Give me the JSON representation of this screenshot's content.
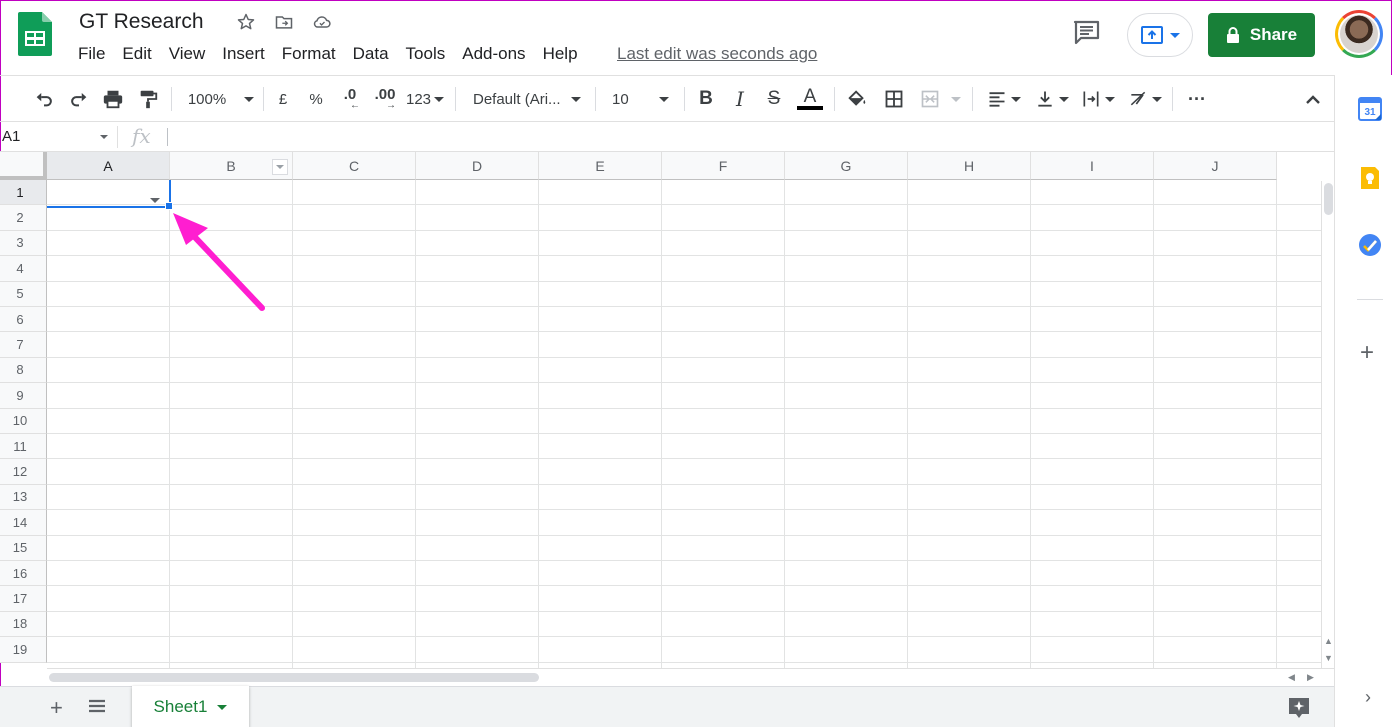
{
  "app": {
    "doc_title": "GT Research",
    "last_edit": "Last edit was seconds ago"
  },
  "menu": [
    "File",
    "Edit",
    "View",
    "Insert",
    "Format",
    "Data",
    "Tools",
    "Add-ons",
    "Help"
  ],
  "header": {
    "share_label": "Share"
  },
  "toolbar": {
    "zoom": "100%",
    "currency": "£",
    "percent": "%",
    "decrease_decimal": ".0",
    "increase_decimal": ".00",
    "more_formats": "123",
    "font": "Default (Ari...",
    "font_size": "10",
    "bold": "B",
    "italic": "I",
    "strike": "S",
    "text_color": "A",
    "more": "···"
  },
  "formula_bar": {
    "name_box": "A1",
    "fx": "fx"
  },
  "grid": {
    "columns": [
      "A",
      "B",
      "C",
      "D",
      "E",
      "F",
      "G",
      "H",
      "I",
      "J"
    ],
    "rows": [
      "1",
      "2",
      "3",
      "4",
      "5",
      "6",
      "7",
      "8",
      "9",
      "10",
      "11",
      "12",
      "13",
      "14",
      "15",
      "16",
      "17",
      "18",
      "19"
    ],
    "selected_cell": "A1"
  },
  "sheets": {
    "tabs": [
      "Sheet1"
    ]
  },
  "sidepanel": {
    "calendar_day": "31"
  },
  "colors": {
    "accent": "#1a73e8",
    "share_green": "#188038",
    "annotation_arrow": "#ff1ed0"
  }
}
